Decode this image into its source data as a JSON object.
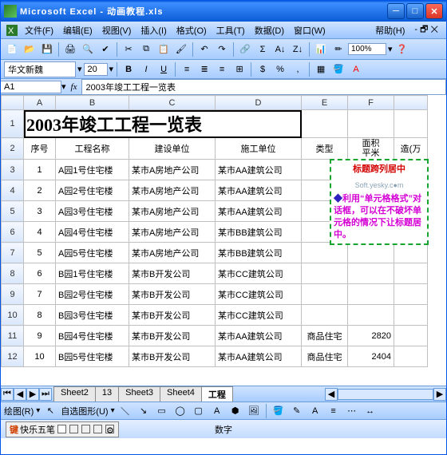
{
  "window": {
    "app": "Microsoft Excel",
    "file": "动画教程.xls"
  },
  "menu": {
    "file": "文件(F)",
    "edit": "编辑(E)",
    "view": "视图(V)",
    "insert": "插入(I)",
    "format": "格式(O)",
    "tools": "工具(T)",
    "data": "数据(D)",
    "window": "窗口(W)",
    "help": "帮助(H)"
  },
  "toolbar": {
    "zoom": "100%"
  },
  "fmt": {
    "font": "华文新魏",
    "size": "20",
    "B": "B",
    "I": "I",
    "U": "U"
  },
  "namebox": "A1",
  "formula": "2003年竣工工程一览表",
  "columns": [
    "A",
    "B",
    "C",
    "D",
    "E",
    "F"
  ],
  "extra_col": "",
  "row_headers": [
    "1",
    "2",
    "3",
    "4",
    "5",
    "6",
    "7",
    "8",
    "9",
    "10",
    "11",
    "12"
  ],
  "title_cell": "2003年竣工工程一览表",
  "headers": {
    "c0": "序号",
    "c1": "工程名称",
    "c2": "建设单位",
    "c3": "施工单位",
    "c4": "类型",
    "c5": "面积\n平米",
    "c6": "造(万"
  },
  "rows": [
    {
      "n": "1",
      "name": "A园1号住宅楼",
      "dev": "某市A房地产公司",
      "con": "某市AA建筑公司",
      "type": "",
      "area": ""
    },
    {
      "n": "2",
      "name": "A园2号住宅楼",
      "dev": "某市A房地产公司",
      "con": "某市AA建筑公司",
      "type": "",
      "area": ""
    },
    {
      "n": "3",
      "name": "A园3号住宅楼",
      "dev": "某市A房地产公司",
      "con": "某市AA建筑公司",
      "type": "",
      "area": ""
    },
    {
      "n": "4",
      "name": "A园4号住宅楼",
      "dev": "某市A房地产公司",
      "con": "某市BB建筑公司",
      "type": "",
      "area": ""
    },
    {
      "n": "5",
      "name": "A园5号住宅楼",
      "dev": "某市A房地产公司",
      "con": "某市BB建筑公司",
      "type": "",
      "area": ""
    },
    {
      "n": "6",
      "name": "B园1号住宅楼",
      "dev": "某市B开发公司",
      "con": "某市CC建筑公司",
      "type": "",
      "area": ""
    },
    {
      "n": "7",
      "name": "B园2号住宅楼",
      "dev": "某市B开发公司",
      "con": "某市CC建筑公司",
      "type": "",
      "area": ""
    },
    {
      "n": "8",
      "name": "B园3号住宅楼",
      "dev": "某市B开发公司",
      "con": "某市CC建筑公司",
      "type": "",
      "area": ""
    },
    {
      "n": "9",
      "name": "B园4号住宅楼",
      "dev": "某市B开发公司",
      "con": "某市AA建筑公司",
      "type": "商品住宅",
      "area": "2820"
    },
    {
      "n": "10",
      "name": "B园5号住宅楼",
      "dev": "某市B开发公司",
      "con": "某市AA建筑公司",
      "type": "商品住宅",
      "area": "2404"
    }
  ],
  "overlay": {
    "title": "标题跨列居中",
    "watermark": "Soft.yesky.c●m",
    "body": "利用“单元格格式”对话框，可以在不破坏单元格的情况下让标题居中。"
  },
  "sheets": [
    "Sheet2",
    "13",
    "Sheet3",
    "Sheet4",
    "工程"
  ],
  "active_sheet": 4,
  "draw": {
    "label": "绘图(R)",
    "autoshape": "自选图形(U)"
  },
  "ime": {
    "name": "快乐五笔"
  },
  "status": {
    "mode": "数字"
  }
}
